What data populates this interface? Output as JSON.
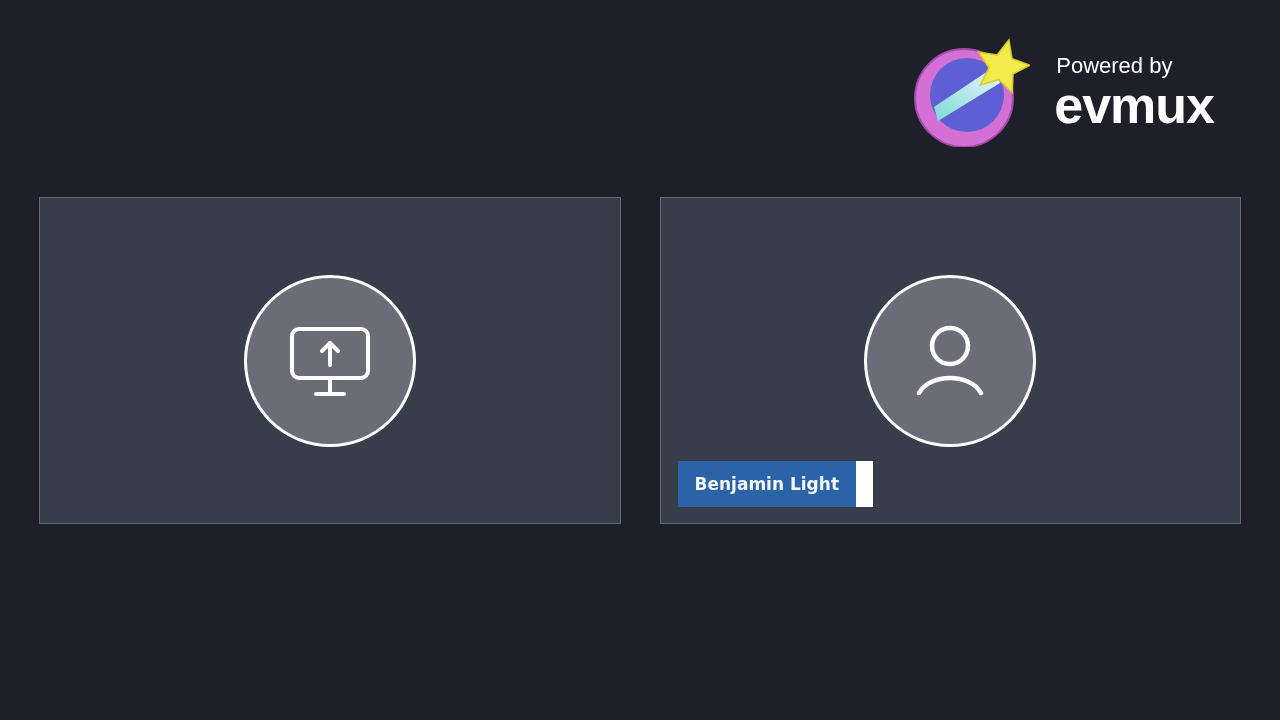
{
  "branding": {
    "tagline": "Powered by",
    "wordmark": "evmux"
  },
  "tiles": [
    {
      "kind": "screen_share"
    },
    {
      "kind": "participant",
      "name": "Benjamin Light"
    }
  ]
}
